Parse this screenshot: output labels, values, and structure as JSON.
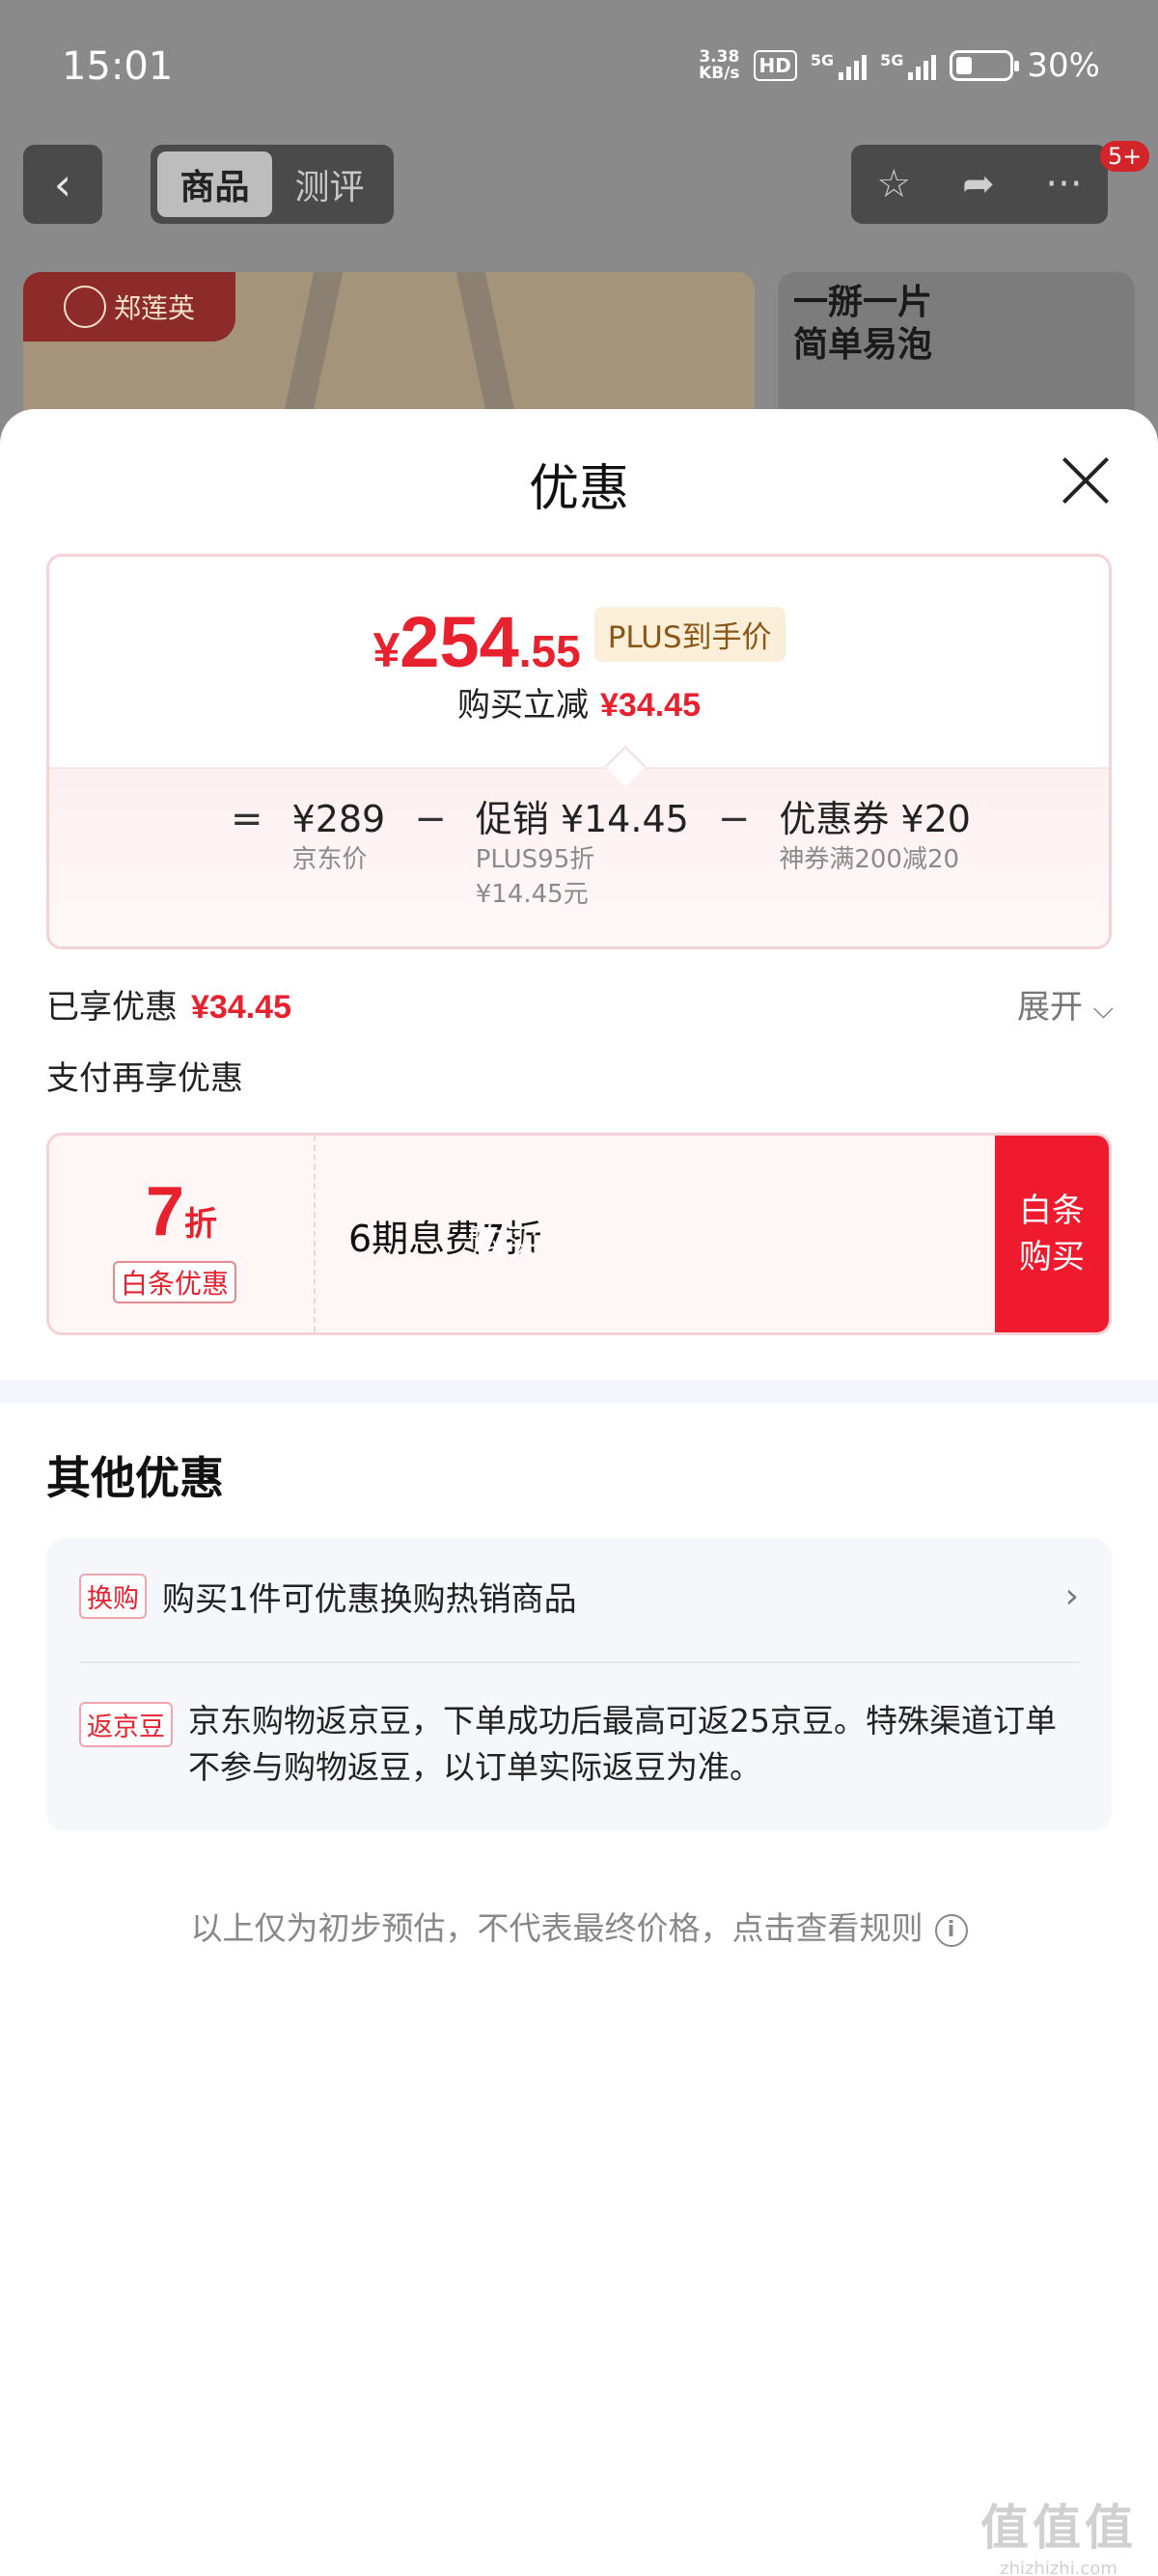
{
  "status_bar": {
    "time": "15:01",
    "net_speed_value": "3.38",
    "net_speed_unit": "KB/s",
    "hd": "HD",
    "net1": "5G",
    "net2": "5G",
    "battery": "30%"
  },
  "nav": {
    "tabs": [
      {
        "label": "商品"
      },
      {
        "label": "测评"
      }
    ],
    "badge": "5+"
  },
  "product": {
    "brand": "郑莲英",
    "slogan_line1": "一掰一片",
    "slogan_line2": "简单易泡"
  },
  "sheet": {
    "title": "优惠",
    "price_card": {
      "currency": "¥",
      "price_int": "254",
      "price_dec": ".55",
      "plus_tag": "PLUS到手价",
      "reduce_label": "购买立减",
      "reduce_amount": "¥34.45",
      "calc": {
        "eq": "=",
        "minus": "−",
        "jd_price": "¥289",
        "jd_price_label": "京东价",
        "promo": "促销 ¥14.45",
        "promo_sub1": "PLUS95折",
        "promo_sub2": "¥14.45元",
        "coupon": "优惠券 ¥20",
        "coupon_sub": "神券满200减20"
      }
    },
    "enjoyed_label": "已享优惠",
    "enjoyed_amount": "¥34.45",
    "expand_label": "展开",
    "pay_more_label": "支付再享优惠",
    "baitiao": {
      "discount_num": "7",
      "discount_unit": "折",
      "tag": "白条优惠",
      "desc": "6期息费7折",
      "ghost": "购买",
      "buy_line1": "白条",
      "buy_line2": "购买"
    },
    "other_title": "其他优惠",
    "other": {
      "row1_tag": "换购",
      "row1_text": "购买1件可优惠换购热销商品",
      "row2_tag": "返京豆",
      "row2_text": "京东购物返京豆，下单成功后最高可返25京豆。特殊渠道订单不参与购物返豆，以订单实际返豆为准。"
    },
    "disclaimer": "以上仅为初步预估，不代表最终价格，点击查看规则"
  },
  "watermark": {
    "big": "值值值",
    "small": "zhizhizhi.com"
  }
}
